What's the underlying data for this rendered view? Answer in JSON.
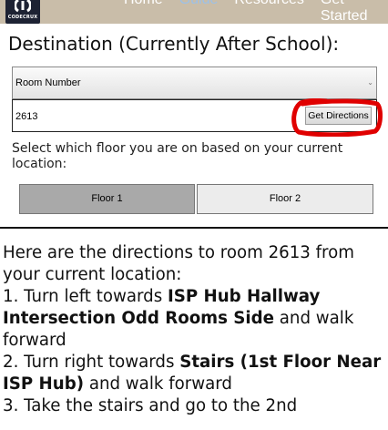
{
  "header": {
    "logo_text": "CODECRUX",
    "nav": [
      {
        "label": "Home"
      },
      {
        "label": "Guide",
        "active": true
      },
      {
        "label": "Resources"
      },
      {
        "label": "Get Started"
      }
    ]
  },
  "destination": {
    "title": "Destination (Currently After School):",
    "select_value": "Room Number",
    "room_input_value": "2613",
    "get_directions_label": "Get Directions",
    "highlight_color": "#e00000"
  },
  "floors": {
    "prompt": "Select which floor you are on based on your current location:",
    "buttons": [
      {
        "label": "Floor 1",
        "selected": true
      },
      {
        "label": "Floor 2",
        "selected": false
      }
    ]
  },
  "directions": {
    "intro": "Here are the directions to room 2613 from your current location:",
    "steps": [
      {
        "prefix": "1. Turn left towards ",
        "target": "ISP Hub Hallway Intersection Odd Rooms Side",
        "suffix": " and walk forward"
      },
      {
        "prefix": "2. Turn right towards ",
        "target": "Stairs (1st Floor Near ISP Hub)",
        "suffix": " and walk forward"
      },
      {
        "prefix": "3. Take the stairs and go to the 2nd",
        "target": "",
        "suffix": ""
      }
    ]
  },
  "colors": {
    "nav_background": "#c9bda9",
    "nav_active": "#9cc1e8",
    "floor_selected": "#a9a9a9",
    "floor_unselected": "#ececec"
  }
}
